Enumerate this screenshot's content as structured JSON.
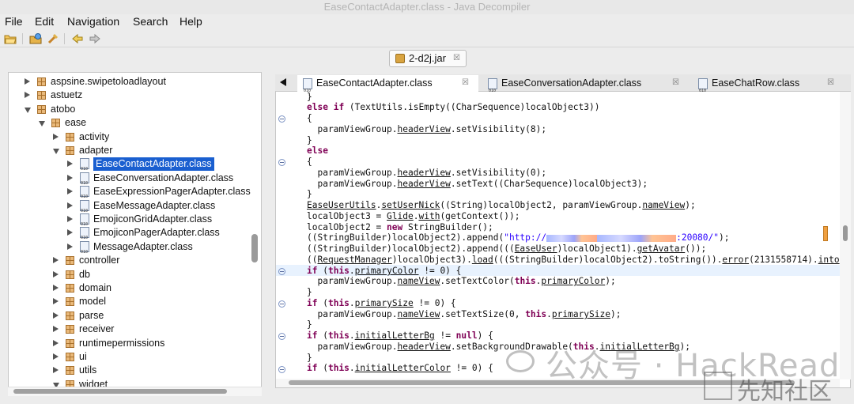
{
  "window": {
    "title": "EaseContactAdapter.class - Java Decompiler"
  },
  "menu": [
    "File",
    "Edit",
    "Navigation",
    "Search",
    "Help"
  ],
  "toolbar": {
    "icons": [
      "open-file-icon",
      "open-folder-icon",
      "search-icon",
      "back-icon",
      "forward-icon"
    ]
  },
  "jar_tab": {
    "label": "2-d2j.jar",
    "close": "☒"
  },
  "tree": [
    {
      "label": "aspsine.swipetoloadlayout",
      "type": "package",
      "expanded": false,
      "level": 1
    },
    {
      "label": "astuetz",
      "type": "package",
      "expanded": false,
      "level": 1
    },
    {
      "label": "atobo",
      "type": "package",
      "expanded": true,
      "level": 1
    },
    {
      "label": "ease",
      "type": "package",
      "expanded": true,
      "level": 2
    },
    {
      "label": "activity",
      "type": "package",
      "expanded": false,
      "level": 3
    },
    {
      "label": "adapter",
      "type": "package",
      "expanded": true,
      "level": 3
    },
    {
      "label": "EaseContactAdapter.class",
      "type": "class",
      "selected": true,
      "level": 4
    },
    {
      "label": "EaseConversationAdapter.class",
      "type": "class",
      "level": 4
    },
    {
      "label": "EaseExpressionPagerAdapter.class",
      "type": "class",
      "level": 4
    },
    {
      "label": "EaseMessageAdapter.class",
      "type": "class",
      "level": 4
    },
    {
      "label": "EmojiconGridAdapter.class",
      "type": "class",
      "level": 4
    },
    {
      "label": "EmojiconPagerAdapter.class",
      "type": "class",
      "level": 4
    },
    {
      "label": "MessageAdapter.class",
      "type": "class",
      "level": 4
    },
    {
      "label": "controller",
      "type": "package",
      "expanded": false,
      "level": 3
    },
    {
      "label": "db",
      "type": "package",
      "expanded": false,
      "level": 3
    },
    {
      "label": "domain",
      "type": "package",
      "expanded": false,
      "level": 3
    },
    {
      "label": "model",
      "type": "package",
      "expanded": false,
      "level": 3
    },
    {
      "label": "parse",
      "type": "package",
      "expanded": false,
      "level": 3
    },
    {
      "label": "receiver",
      "type": "package",
      "expanded": false,
      "level": 3
    },
    {
      "label": "runtimepermissions",
      "type": "package",
      "expanded": false,
      "level": 3
    },
    {
      "label": "ui",
      "type": "package",
      "expanded": false,
      "level": 3
    },
    {
      "label": "utils",
      "type": "package",
      "expanded": false,
      "level": 3
    },
    {
      "label": "widget",
      "type": "package",
      "expanded": true,
      "level": 3
    }
  ],
  "editor_tabs": [
    {
      "label": "EaseContactAdapter.class",
      "active": true,
      "close": "☒"
    },
    {
      "label": "EaseConversationAdapter.class",
      "active": false,
      "close": "☒"
    },
    {
      "label": "EaseChatRow.class",
      "active": false,
      "close": "☒"
    }
  ],
  "watermark": {
    "text": "公众号 · HackRead",
    "text2": "先知社区"
  }
}
